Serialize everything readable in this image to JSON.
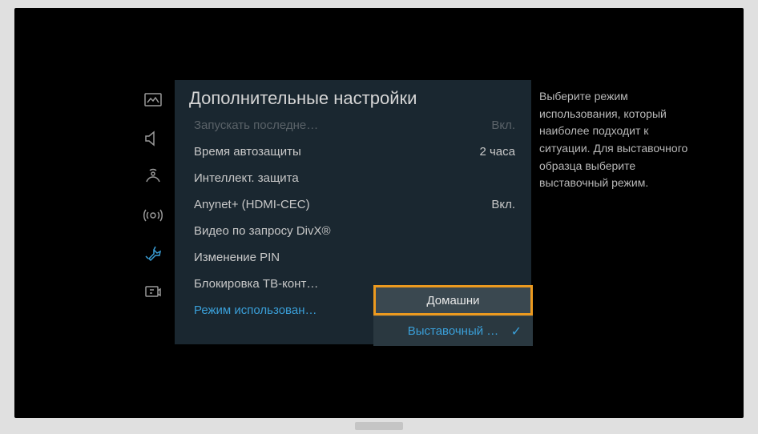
{
  "title": "Дополнительные настройки",
  "sidebar_icons": [
    {
      "name": "picture-icon"
    },
    {
      "name": "sound-icon"
    },
    {
      "name": "broadcast-icon"
    },
    {
      "name": "network-icon"
    },
    {
      "name": "system-icon"
    },
    {
      "name": "support-icon"
    }
  ],
  "settings": [
    {
      "label": "Запускать последне…",
      "value": "Вкл.",
      "dimmed": true
    },
    {
      "label": "Время автозащиты",
      "value": "2 часа"
    },
    {
      "label": "Интеллект. защита",
      "value": ""
    },
    {
      "label": "Anynet+ (HDMI-CEC)",
      "value": "Вкл."
    },
    {
      "label": "Видео по запросу DivX®",
      "value": ""
    },
    {
      "label": "Изменение PIN",
      "value": ""
    },
    {
      "label": "Блокировка ТВ-конт…",
      "value": ""
    },
    {
      "label": "Режим использован…",
      "value": "",
      "selected": true
    }
  ],
  "dropdown": {
    "options": [
      {
        "label": "Домашни",
        "highlighted": true
      },
      {
        "label": "Выставочный …",
        "selected": true
      }
    ]
  },
  "help_text": "Выберите режим использования, который наиболее подходит к ситуации. Для выставочного образца выберите выставочный режим."
}
